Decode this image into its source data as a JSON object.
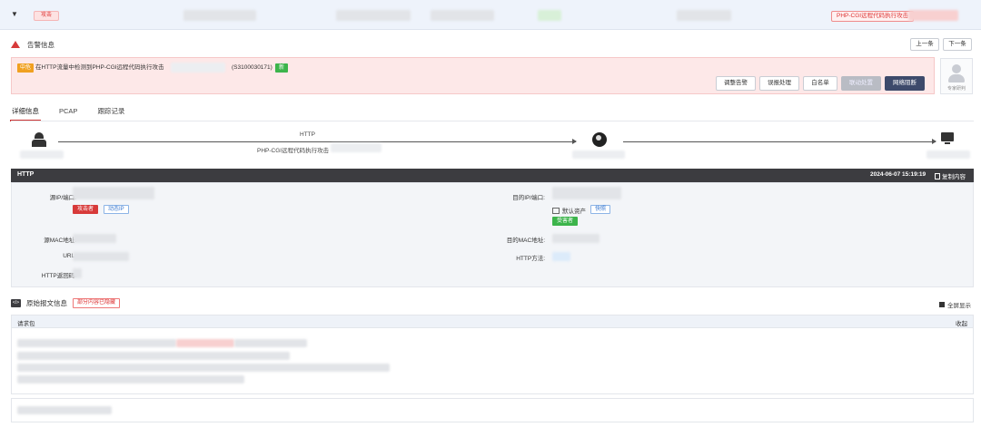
{
  "topbar": {
    "attack_tag": "攻击",
    "rule_tag": "PHP-CGI远程代码执行攻击"
  },
  "alarm": {
    "section_title": "告警信息",
    "prev_label": "上一条",
    "next_label": "下一条",
    "level": "中危",
    "message": "在HTTP流量中检测到PHP-CGI远程代码执行攻击",
    "rule_id": "(S3100030171)",
    "new_badge": "新",
    "actions": {
      "adjust": "调整告警",
      "process": "误报处理",
      "whitelist": "白名单",
      "linkage": "联动处置",
      "block": "网络阻断"
    },
    "expert_label": "专家研判"
  },
  "tabs": [
    {
      "label": "详细信息"
    },
    {
      "label": "PCAP"
    },
    {
      "label": "跟踪记录"
    }
  ],
  "flow": {
    "protocol": "HTTP",
    "rule": "PHP-CGI远程代码执行攻击"
  },
  "http": {
    "title": "HTTP",
    "timestamp": "2024-06-07 15:19:19",
    "copy_label": "复制内容",
    "src_label": "源IP/端口:",
    "attacker_chip": "攻击者",
    "dynamic_ip_chip": "动态IP",
    "dst_label": "目的IP/端口:",
    "default_asset": "默认资产",
    "snapshot_chip": "快照",
    "victim_chip": "受害者",
    "src_mac_label": "源MAC地址:",
    "dst_mac_label": "目的MAC地址:",
    "url_label": "URL:",
    "method_label": "HTTP方法:",
    "resp_code_label": "HTTP返回码:"
  },
  "raw": {
    "title": "原始报文信息",
    "tag": "部分内容已隐藏",
    "fullscreen_label": "全屏显示",
    "request_label": "请求包",
    "collapse_label": "收起"
  },
  "colors": {
    "accent_red": "#d73a3a",
    "primary_dark": "#3d4a6b",
    "success_green": "#3cb44b",
    "warn_orange": "#f0a020"
  }
}
